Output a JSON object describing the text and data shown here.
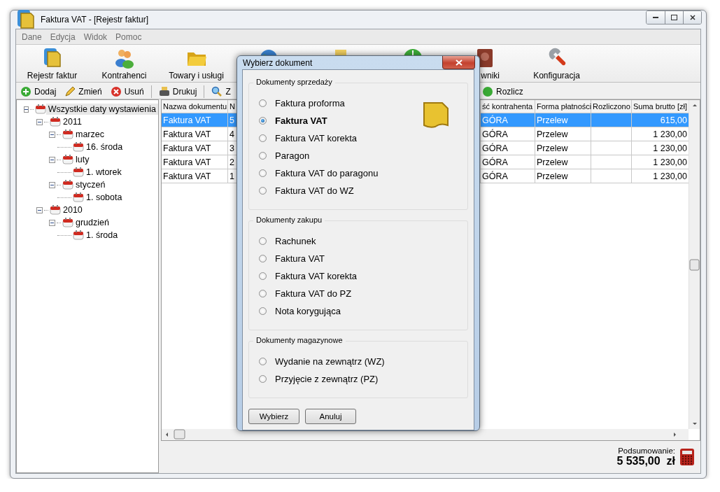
{
  "window": {
    "title": "Faktura VAT - [Rejestr faktur]"
  },
  "menu": [
    "Dane",
    "Edycja",
    "Widok",
    "Pomoc"
  ],
  "toolbar": [
    {
      "label": "Rejestr faktur",
      "kind": "document"
    },
    {
      "label": "Kontrahenci",
      "kind": "people"
    },
    {
      "label": "Towary i usługi",
      "kind": "folder"
    },
    {
      "kind": "globe"
    },
    {
      "kind": "printer"
    },
    {
      "kind": "clock"
    },
    {
      "label": "wniki",
      "kind": "book"
    },
    {
      "label": "Konfiguracja",
      "kind": "wrench"
    }
  ],
  "actions_left": [
    {
      "label": "Dodaj",
      "kind": "add"
    },
    {
      "label": "Zmień",
      "kind": "edit"
    },
    {
      "label": "Usuń",
      "kind": "delete"
    },
    {
      "label": "Drukuj",
      "kind": "print"
    },
    {
      "label": "Z",
      "kind": "search"
    }
  ],
  "actions_right": [
    {
      "label": "Rozlicz",
      "kind": "settle"
    }
  ],
  "tree": [
    {
      "label": "Wszystkie daty wystawienia",
      "selected": true,
      "expanded": true,
      "children": [
        {
          "label": "2011",
          "selected": false,
          "expanded": true,
          "children": [
            {
              "label": "marzec",
              "selected": false,
              "expanded": true,
              "children": [
                {
                  "label": "16. środa",
                  "selected": false
                }
              ]
            },
            {
              "label": "luty",
              "selected": false,
              "expanded": true,
              "children": [
                {
                  "label": "1. wtorek",
                  "selected": false
                }
              ]
            },
            {
              "label": "styczeń",
              "selected": false,
              "expanded": true,
              "children": [
                {
                  "label": "1. sobota",
                  "selected": false
                }
              ]
            }
          ]
        },
        {
          "label": "2010",
          "selected": false,
          "expanded": true,
          "children": [
            {
              "label": "grudzień",
              "selected": false,
              "expanded": true,
              "children": [
                {
                  "label": "1. środa",
                  "selected": false
                }
              ]
            }
          ]
        }
      ]
    }
  ],
  "table": {
    "columns": [
      "Nazwa dokumentu",
      "N",
      "ść kontrahenta",
      "Forma płatności",
      "Rozliczono",
      "Suma brutto [zł]"
    ],
    "rows": [
      {
        "selected": true,
        "cells": [
          "Faktura VAT",
          "5",
          "GÓRA",
          "Przelew",
          "",
          "615,00"
        ]
      },
      {
        "selected": false,
        "cells": [
          "Faktura VAT",
          "4",
          "GÓRA",
          "Przelew",
          "",
          "1 230,00"
        ]
      },
      {
        "selected": false,
        "cells": [
          "Faktura VAT",
          "3",
          "GÓRA",
          "Przelew",
          "",
          "1 230,00"
        ]
      },
      {
        "selected": false,
        "cells": [
          "Faktura VAT",
          "2",
          "GÓRA",
          "Przelew",
          "",
          "1 230,00"
        ]
      },
      {
        "selected": false,
        "cells": [
          "Faktura VAT",
          "1",
          "GÓRA",
          "Przelew",
          "",
          "1 230,00"
        ]
      }
    ]
  },
  "summary": {
    "label": "Podsumowanie:",
    "value": "5 535,00  zł"
  },
  "dialog": {
    "title": "Wybierz dokument",
    "groups": [
      {
        "title": "Dokumenty sprzedaży",
        "options": [
          {
            "label": "Faktura proforma",
            "selected": false
          },
          {
            "label": "Faktura VAT",
            "selected": true
          },
          {
            "label": "Faktura VAT korekta",
            "selected": false
          },
          {
            "label": "Paragon",
            "selected": false
          },
          {
            "label": "Faktura VAT do paragonu",
            "selected": false
          },
          {
            "label": "Faktura VAT do WZ",
            "selected": false
          }
        ]
      },
      {
        "title": "Dokumenty zakupu",
        "options": [
          {
            "label": "Rachunek",
            "selected": false
          },
          {
            "label": "Faktura VAT",
            "selected": false
          },
          {
            "label": "Faktura VAT korekta",
            "selected": false
          },
          {
            "label": "Faktura VAT do PZ",
            "selected": false
          },
          {
            "label": "Nota korygująca",
            "selected": false
          }
        ]
      },
      {
        "title": "Dokumenty magazynowe",
        "options": [
          {
            "label": "Wydanie na zewnątrz (WZ)",
            "selected": false
          },
          {
            "label": "Przyjęcie z zewnątrz (PZ)",
            "selected": false
          }
        ]
      }
    ],
    "buttons": [
      "Wybierz",
      "Anuluj"
    ]
  }
}
